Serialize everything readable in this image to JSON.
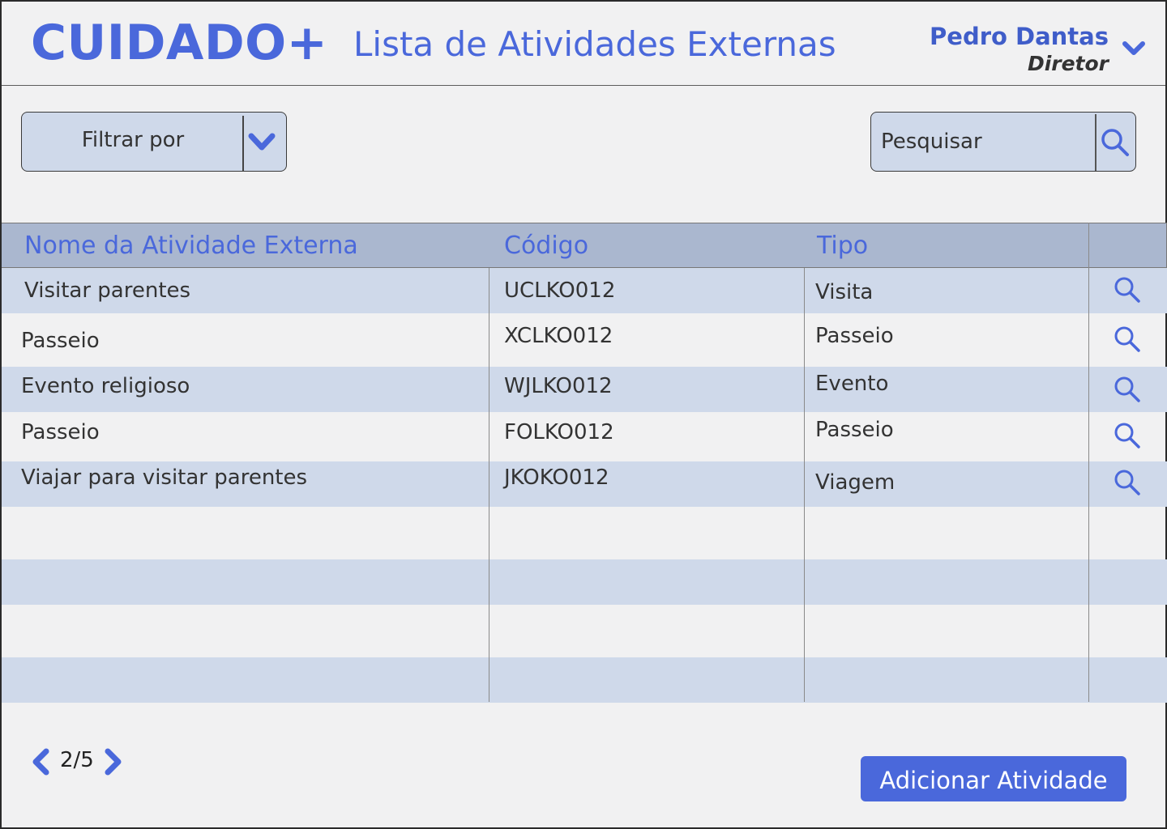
{
  "header": {
    "logo": "CUIDADO+",
    "title": "Lista de Atividades Externas",
    "user": {
      "name": "Pedro Dantas",
      "role": "Diretor"
    }
  },
  "toolbar": {
    "filter_label": "Filtrar por",
    "search_placeholder": "Pesquisar"
  },
  "table": {
    "columns": [
      "Nome da Atividade Externa",
      "Código",
      "Tipo"
    ],
    "rows": [
      {
        "name": "Visitar parentes",
        "code": "UCLKO012",
        "type": "Visita"
      },
      {
        "name": "Passeio",
        "code": "XCLKO012",
        "type": "Passeio"
      },
      {
        "name": "Evento religioso",
        "code": "WJLKO012",
        "type": "Evento"
      },
      {
        "name": "Passeio",
        "code": "FOLKO012",
        "type": "Passeio"
      },
      {
        "name": "Viajar para visitar parentes",
        "code": "JKOKO012",
        "type": "Viagem"
      }
    ],
    "empty_rows": 4
  },
  "pagination": {
    "label": "2/5",
    "current": 2,
    "total": 5
  },
  "actions": {
    "add_label": "Adicionar Atividade"
  },
  "colors": {
    "accent": "#4a68db",
    "row_alt": "#cfd9ea",
    "header_bg": "#aab7cf",
    "background": "#f1f1f2"
  },
  "icons": {
    "user_menu": "chevron-down-icon",
    "filter": "chevron-down-icon",
    "search": "search-icon",
    "row_action": "search-icon",
    "prev": "chevron-left-icon",
    "next": "chevron-right-icon"
  }
}
